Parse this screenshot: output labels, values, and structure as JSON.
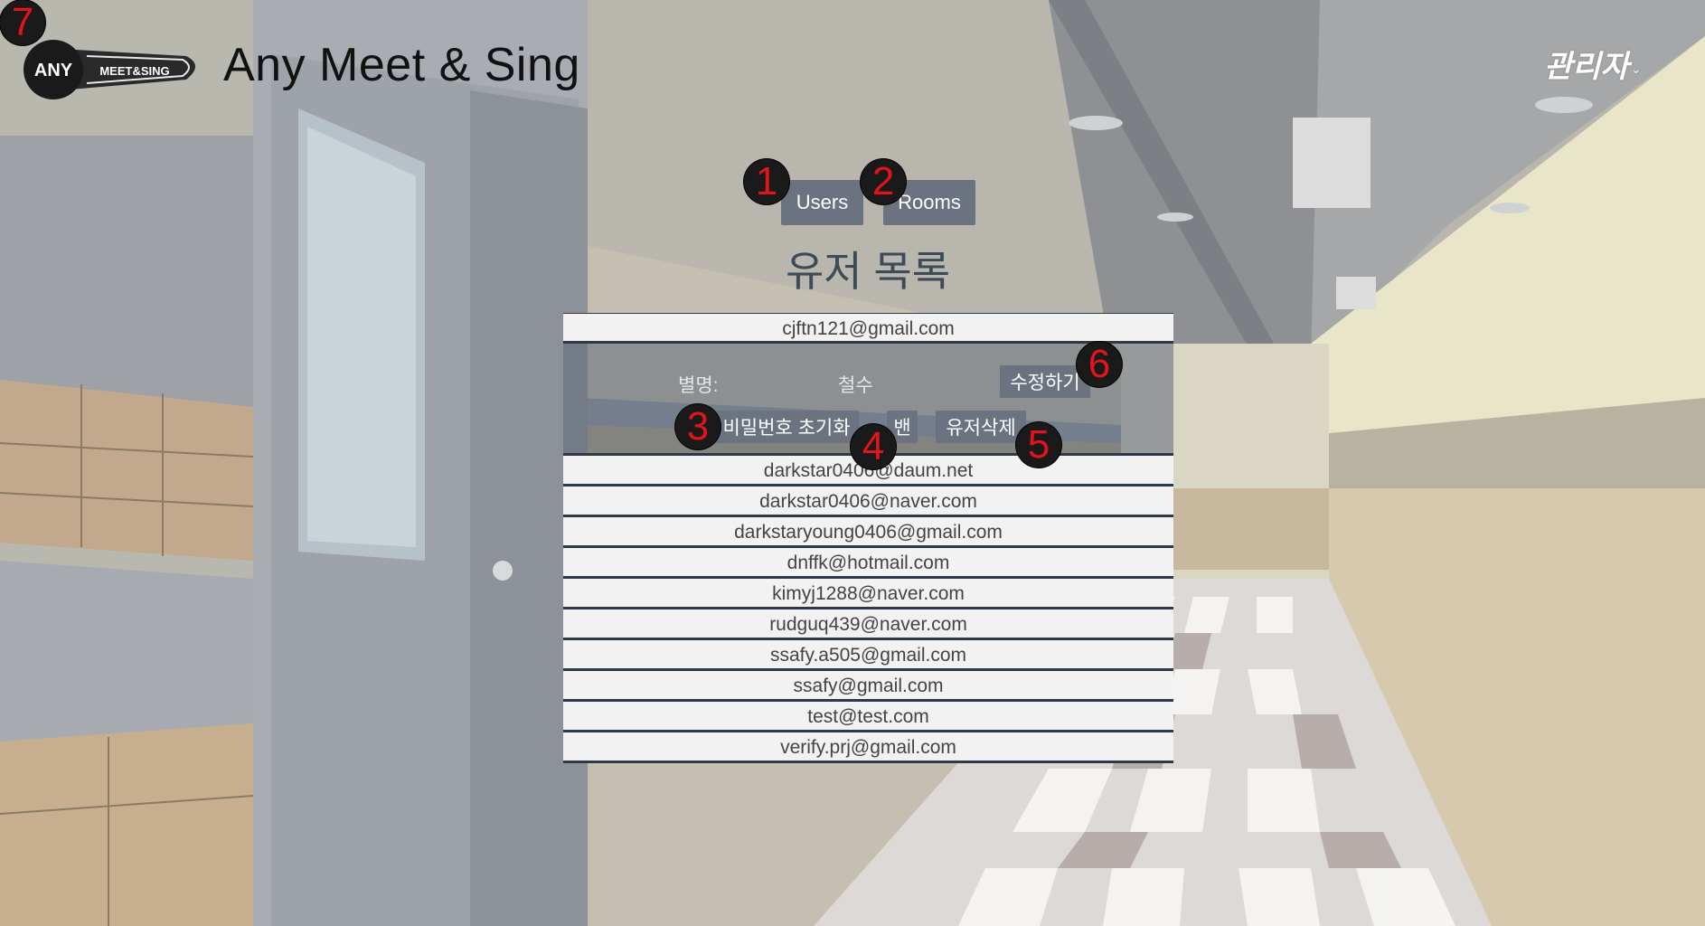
{
  "header": {
    "title": "Any Meet & Sing",
    "logo_text_main": "ANY",
    "logo_text_sub": "MEET&SING",
    "admin_label": "관리자",
    "admin_caret": "⌄"
  },
  "tabs": [
    {
      "label": "Users"
    },
    {
      "label": "Rooms"
    }
  ],
  "list_title": "유저 목록",
  "users": {
    "selected": "cjftn121@gmail.com",
    "detail": {
      "nickname_label": "별명:",
      "nickname_value": "철수",
      "edit_button": "수정하기",
      "reset_password_button": "비밀번호 초기화",
      "ban_button": "밴",
      "delete_button": "유저삭제"
    },
    "rows": [
      "darkstar0406@daum.net",
      "darkstar0406@naver.com",
      "darkstaryoung0406@gmail.com",
      "dnffk@hotmail.com",
      "kimyj1288@naver.com",
      "rudguq439@naver.com",
      "ssafy.a505@gmail.com",
      "ssafy@gmail.com",
      "test@test.com",
      "verify.prj@gmail.com"
    ]
  },
  "markers": [
    "1",
    "2",
    "3",
    "4",
    "5",
    "6",
    "7"
  ],
  "colors": {
    "button_bg": "#6b7380",
    "row_bg": "#f2f2f3",
    "row_border": "#2f3946",
    "marker_number": "#e0141a",
    "marker_bg": "#1a1a1a"
  }
}
